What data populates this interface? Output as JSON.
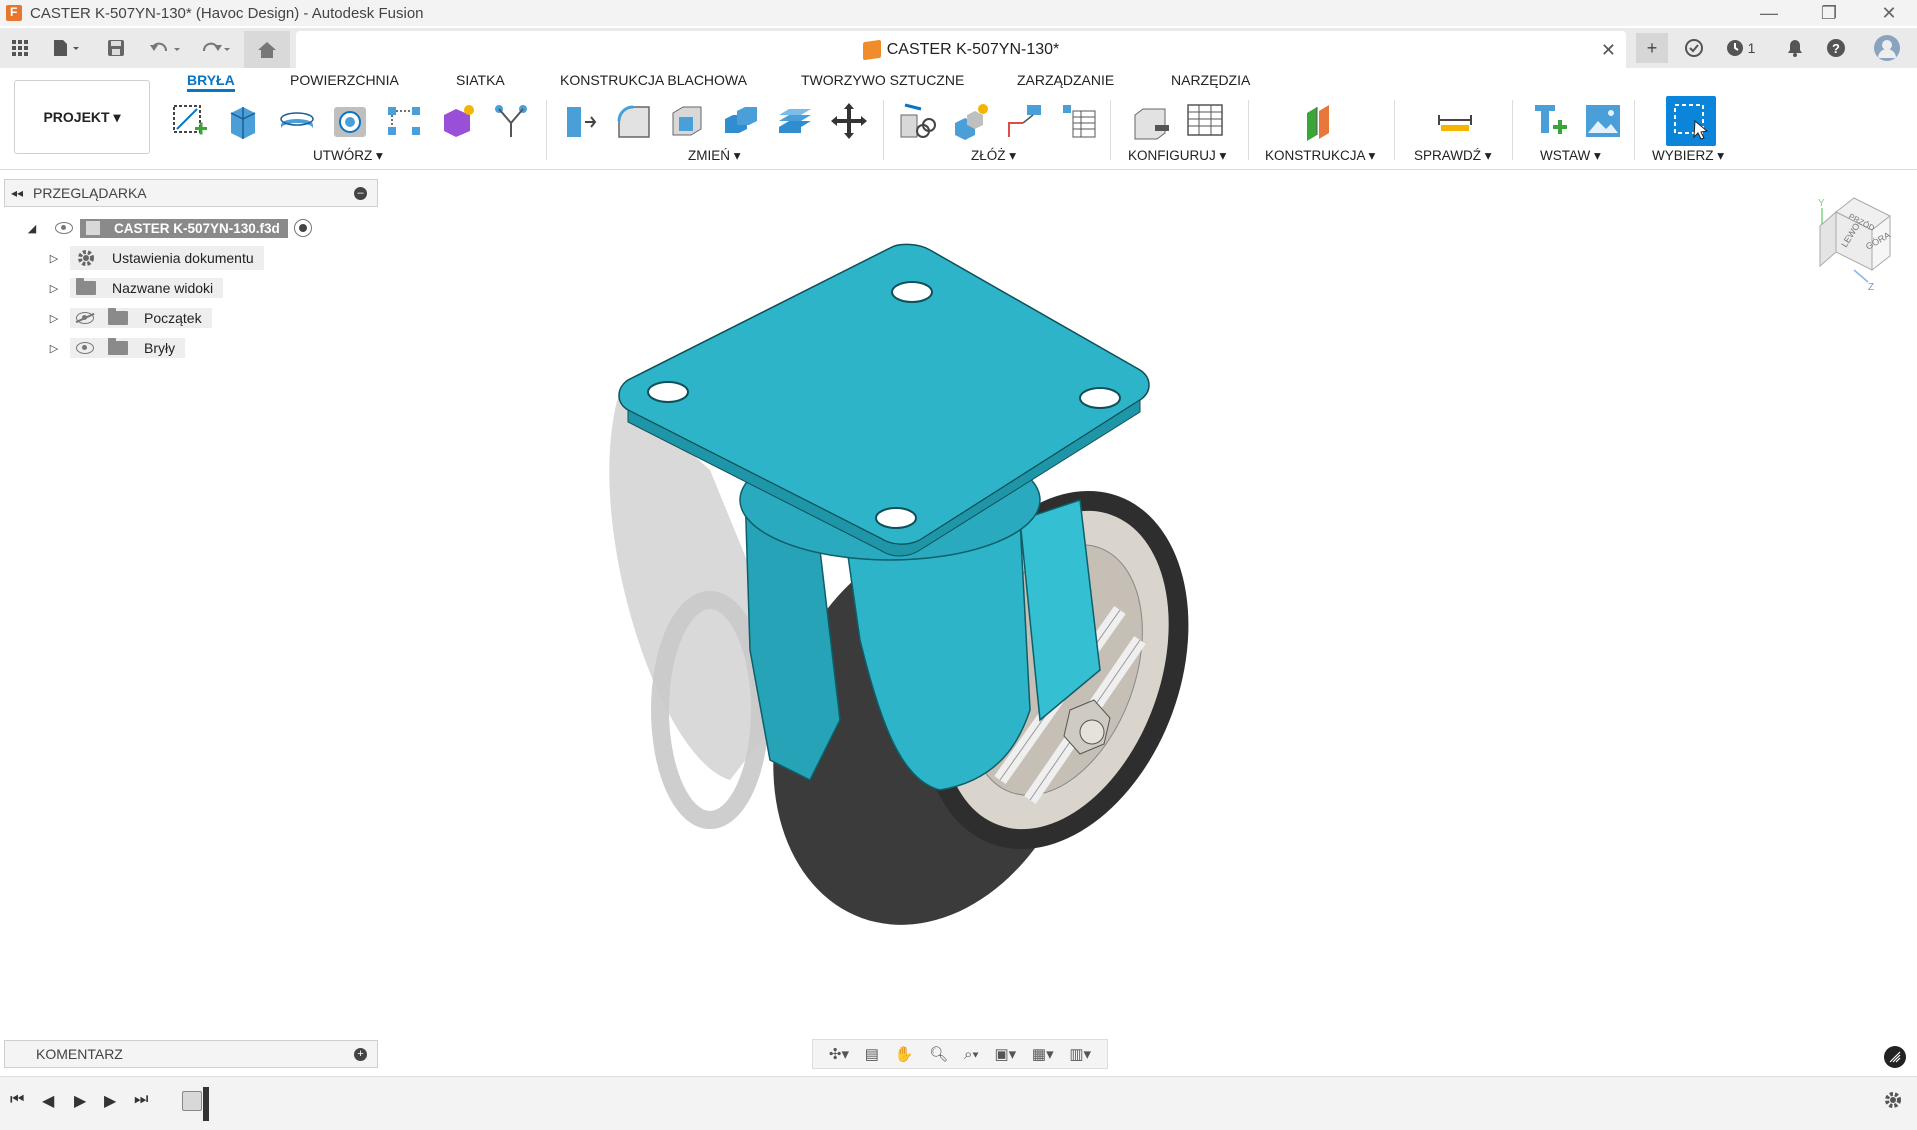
{
  "window": {
    "title": "CASTER K-507YN-130* (Havoc Design) - Autodesk Fusion",
    "minimize": "—",
    "restore": "❐",
    "close": "✕"
  },
  "document_tab": {
    "title": "CASTER K-507YN-130*",
    "close": "✕",
    "jobs_count": "1"
  },
  "ribbon": {
    "project_button": "PROJEKT ▾",
    "tabs": [
      "BRYŁA",
      "POWIERZCHNIA",
      "SIATKA",
      "KONSTRUKCJA BLACHOWA",
      "TWORZYWO SZTUCZNE",
      "ZARZĄDZANIE",
      "NARZĘDZIA"
    ],
    "groups": [
      "UTWÓRZ ▾",
      "ZMIEŃ ▾",
      "ZŁÓŻ ▾",
      "KONFIGURUJ ▾",
      "KONSTRUKCJA ▾",
      "SPRAWDŹ ▾",
      "WSTAW ▾",
      "WYBIERZ ▾"
    ]
  },
  "browser": {
    "header": "PRZEGLĄDARKA",
    "root": "CASTER K-507YN-130.f3d",
    "items": [
      "Ustawienia dokumentu",
      "Nazwane widoki",
      "Początek",
      "Bryły"
    ]
  },
  "comment": {
    "label": "KOMENTARZ"
  },
  "viewcube": {
    "top_label": "GÓRA",
    "front_label": "PRZÓD",
    "left_label": "LEWO",
    "axis_y": "Y",
    "axis_z": "Z"
  },
  "colors": {
    "accent": "#0a75c4",
    "model_body": "#2eb4c8",
    "wheel": "#3a3a3a"
  }
}
